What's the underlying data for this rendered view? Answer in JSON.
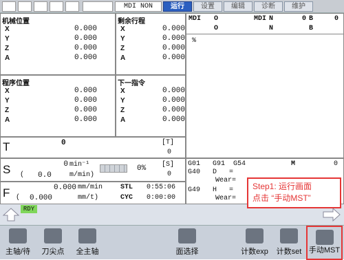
{
  "topbar": {
    "mode": "MDI NON",
    "tabs": [
      "运行",
      "设置",
      "编辑",
      "诊断",
      "维护"
    ]
  },
  "machine_pos": {
    "title": "机械位置",
    "axes": [
      {
        "name": "X",
        "value": "0.000"
      },
      {
        "name": "Y",
        "value": "0.000"
      },
      {
        "name": "Z",
        "value": "0.000"
      },
      {
        "name": "A",
        "value": "0.000"
      }
    ]
  },
  "remaining": {
    "title": "剩余行程",
    "axes": [
      {
        "name": "X",
        "value": "0.000"
      },
      {
        "name": "Y",
        "value": "0.000"
      },
      {
        "name": "Z",
        "value": "0.000"
      },
      {
        "name": "A",
        "value": "0.000"
      }
    ]
  },
  "program_pos": {
    "title": "程序位置",
    "axes": [
      {
        "name": "X",
        "value": "0.000"
      },
      {
        "name": "Y",
        "value": "0.000"
      },
      {
        "name": "Z",
        "value": "0.000"
      },
      {
        "name": "A",
        "value": "0.000"
      }
    ]
  },
  "next_cmd": {
    "title": "下一指令",
    "axes": [
      {
        "name": "X",
        "value": "0.000"
      },
      {
        "name": "Y",
        "value": "0.000"
      },
      {
        "name": "Z",
        "value": "0.000"
      },
      {
        "name": "A",
        "value": "0.000"
      }
    ]
  },
  "mdi_panel": {
    "row1": {
      "label": "MDI",
      "o": "O",
      "mdi": "MDI",
      "n": "N",
      "zero": "0",
      "b": "B",
      "b_val": "0"
    },
    "row2": {
      "o": "O",
      "n": "N",
      "b": "B"
    },
    "content": "%"
  },
  "tool": {
    "label": "T",
    "value": "0",
    "bracket": "[T]",
    "bracket_val": "0"
  },
  "spindle": {
    "label": "S",
    "rpm": "0",
    "rpm_unit": "min⁻¹",
    "paren_open": "(",
    "feed": "0.0",
    "feed_unit": "m/min)",
    "pct": "0%",
    "bracket": "[S]",
    "bracket_val": "0"
  },
  "feed": {
    "label": "F",
    "rate": "0.000",
    "rate_unit": "mm/min",
    "paren_open": "(",
    "actual": "0.000",
    "actual_unit": "mm/t)",
    "stl": "STL",
    "stl_time": "0:55:06",
    "cyc": "CYC",
    "cyc_time": "0:00:00"
  },
  "gcodes": {
    "line1": "G01   G91  G54",
    "m": "M",
    "m_val": "0",
    "line2": "G40   D   =",
    "wear1": "Wear=",
    "line3": "G49   H   =",
    "wear2": "Wear="
  },
  "status": {
    "rdy": "RDY"
  },
  "callout": {
    "line1": "Step1: 运行画面",
    "line2": "点击 “手动MST”"
  },
  "softkeys": [
    "主轴/待",
    "刀尖点",
    "全主轴",
    "面选择",
    "计数exp",
    "计数set",
    "手动MST"
  ]
}
